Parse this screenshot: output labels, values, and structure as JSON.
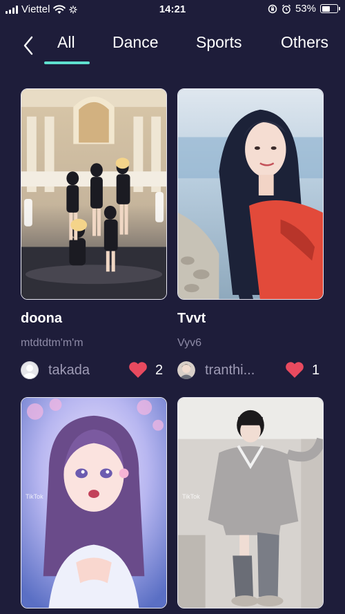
{
  "status_bar": {
    "carrier": "Viettel",
    "time": "14:21",
    "battery": "53%",
    "battery_level": 0.53,
    "icons": [
      "signal-icon",
      "wifi-icon",
      "loading-icon",
      "orientation-lock-icon",
      "alarm-icon",
      "battery-icon"
    ]
  },
  "tabs": [
    {
      "label": "All",
      "active": true
    },
    {
      "label": "Dance",
      "active": false
    },
    {
      "label": "Sports",
      "active": false
    },
    {
      "label": "Others",
      "active": false
    }
  ],
  "accent_color": "#5fe0cf",
  "like_color": "#e84a5f",
  "background_color": "#1e1d3a",
  "videos": [
    {
      "title": "doona",
      "description": "mtdtdtm'm'm",
      "author": "takada",
      "likes": "2",
      "thumbnail": "girl-group-dance-stage"
    },
    {
      "title": "Tvvt",
      "description": "Vyv6",
      "author": "tranthi...",
      "likes": "1",
      "thumbnail": "girl-by-the-sea"
    },
    {
      "title": "",
      "description": "",
      "author": "",
      "likes": "",
      "thumbnail": "anime-girl-portrait",
      "watermark": "TikTok"
    },
    {
      "title": "",
      "description": "",
      "author": "",
      "likes": "",
      "thumbnail": "girl-in-oversized-hoodie",
      "watermark": "TikTok"
    }
  ]
}
